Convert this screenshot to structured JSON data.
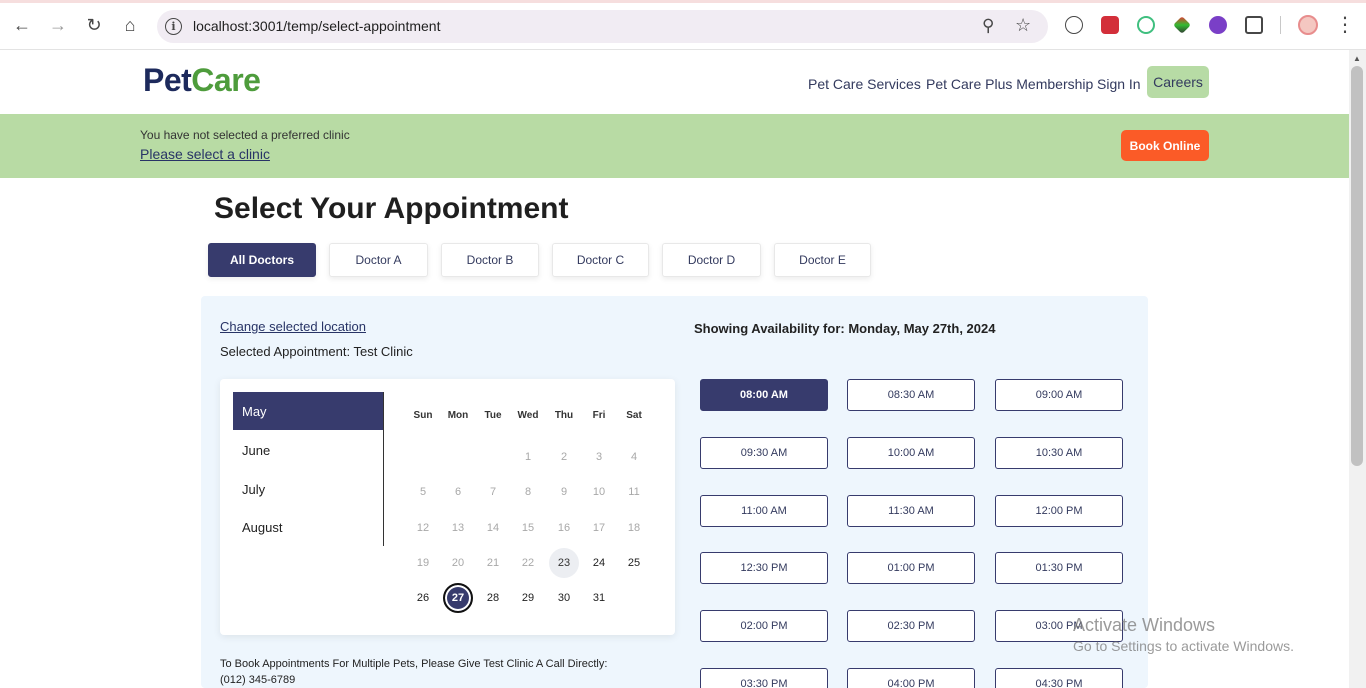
{
  "browser": {
    "url": "localhost:3001/temp/select-appointment"
  },
  "brand": {
    "pet": "Pet",
    "care": "Care"
  },
  "nav": {
    "services": "Pet Care Services",
    "membership": "Pet Care Plus Membership",
    "sign_in": "Sign In",
    "careers": "Careers"
  },
  "banner": {
    "message": "You have not selected a preferred clinic",
    "select_link": "Please select a clinic",
    "book_online": "Book Online"
  },
  "page_title": "Select Your Appointment",
  "doctors": [
    "All Doctors",
    "Doctor A",
    "Doctor B",
    "Doctor C",
    "Doctor D",
    "Doctor E"
  ],
  "location": {
    "change_link": "Change selected location",
    "selected_appointment": "Selected Appointment: Test Clinic"
  },
  "calendar": {
    "months": [
      "May",
      "June",
      "July",
      "August"
    ],
    "weekdays": [
      "Sun",
      "Mon",
      "Tue",
      "Wed",
      "Thu",
      "Fri",
      "Sat"
    ],
    "week_rows": [
      [
        "",
        "",
        "",
        "1",
        "2",
        "3",
        "4"
      ],
      [
        "5",
        "6",
        "7",
        "8",
        "9",
        "10",
        "11"
      ],
      [
        "12",
        "13",
        "14",
        "15",
        "16",
        "17",
        "18"
      ],
      [
        "19",
        "20",
        "21",
        "22",
        "23",
        "24",
        "25"
      ],
      [
        "26",
        "27",
        "28",
        "29",
        "30",
        "31",
        ""
      ]
    ],
    "today": "23",
    "selected_day": "27"
  },
  "availability": {
    "heading": "Showing Availability for: Monday, May 27th, 2024",
    "slots": [
      "08:00 AM",
      "08:30 AM",
      "09:00 AM",
      "09:30 AM",
      "10:00 AM",
      "10:30 AM",
      "11:00 AM",
      "11:30 AM",
      "12:00 PM",
      "12:30 PM",
      "01:00 PM",
      "01:30 PM",
      "02:00 PM",
      "02:30 PM",
      "03:00 PM",
      "03:30 PM",
      "04:00 PM",
      "04:30 PM"
    ],
    "selected_slot": "08:00 AM"
  },
  "multi_pets": {
    "line1": "To Book Appointments For Multiple Pets, Please Give Test Clinic A Call Directly:",
    "phone": "(012) 345-6789"
  },
  "watermark": {
    "line1": "Activate Windows",
    "line2": "Go to Settings to activate Windows."
  },
  "colors": {
    "brand_navy": "#373b6d",
    "brand_green": "#4e9c3c",
    "banner_green": "#b8dba4",
    "book_orange": "#fb5b27"
  }
}
